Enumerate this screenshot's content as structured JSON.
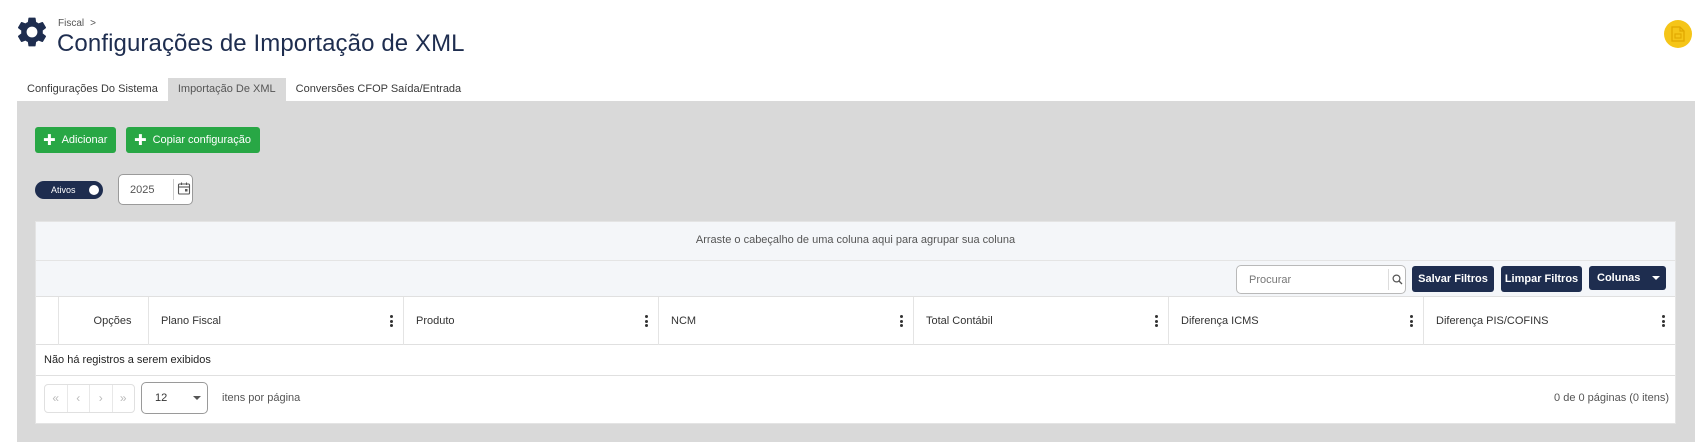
{
  "header": {
    "breadcrumb": "Fiscal",
    "breadcrumb_sep": ">",
    "title": "Configurações de Importação de XML"
  },
  "tabs": [
    {
      "label": "Configurações Do Sistema",
      "active": false
    },
    {
      "label": "Importação De XML",
      "active": true
    },
    {
      "label": "Conversões CFOP Saída/Entrada",
      "active": false
    }
  ],
  "actions": {
    "add_label": "Adicionar",
    "copy_label": "Copiar configuração"
  },
  "filters": {
    "toggle_label": "Ativos",
    "toggle_on": true,
    "year": "2025"
  },
  "grid": {
    "group_hint": "Arraste o cabeçalho de uma coluna aqui para agrupar sua coluna",
    "search_placeholder": "Procurar",
    "save_filters_label": "Salvar Filtros",
    "clear_filters_label": "Limpar Filtros",
    "columns_label": "Colunas",
    "columns": [
      "Opções",
      "Plano Fiscal",
      "Produto",
      "NCM",
      "Total Contábil",
      "Diferença ICMS",
      "Diferença PIS/COFINS"
    ],
    "empty_message": "Não há registros a serem exibidos",
    "pager": {
      "first": "«",
      "prev": "‹",
      "next": "›",
      "last": "»",
      "page_size": "12",
      "per_page_label": "itens por página",
      "info": "0 de 0 páginas (0 itens)"
    }
  },
  "colors": {
    "navy": "#1e2d4f",
    "green": "#28a745",
    "panel": "#d9d9d9",
    "badge": "#f5c518"
  },
  "icons": {
    "settings": "gear-icon",
    "help": "document-help-icon",
    "calendar": "calendar-icon",
    "search": "search-icon",
    "add": "plus-icon"
  }
}
